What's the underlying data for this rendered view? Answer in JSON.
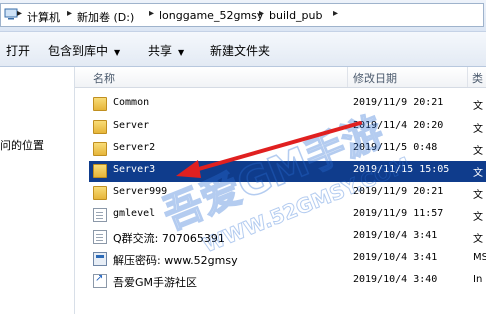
{
  "address": {
    "segments": [
      "计算机",
      "新加卷 (D:)",
      "longgame_52gmsy",
      "build_pub"
    ],
    "separator": "▸"
  },
  "toolbar": {
    "open_label": "打开",
    "include_label": "包含到库中",
    "share_label": "共享",
    "new_folder_label": "新建文件夹"
  },
  "nav": {
    "recent_places_label": "问的位置"
  },
  "columns": {
    "name": "名称",
    "modified": "修改日期",
    "type": "类"
  },
  "files": [
    {
      "name": "Common",
      "date": "2019/11/9 20:21",
      "type": "文",
      "icon": "folder-icon",
      "selected": false
    },
    {
      "name": "Server",
      "date": "2019/11/4 20:20",
      "type": "文",
      "icon": "folder-icon",
      "selected": false
    },
    {
      "name": "Server2",
      "date": "2019/11/5 0:48",
      "type": "文",
      "icon": "folder-icon",
      "selected": false
    },
    {
      "name": "Server3",
      "date": "2019/11/15 15:05",
      "type": "文",
      "icon": "folder-icon",
      "selected": true
    },
    {
      "name": "Server999",
      "date": "2019/11/9 20:21",
      "type": "文",
      "icon": "folder-icon",
      "selected": false
    },
    {
      "name": "gmlevel",
      "date": "2019/11/9 11:57",
      "type": "文",
      "icon": "file-icon",
      "selected": false
    },
    {
      "name": "Q群交流: 707065391",
      "date": "2019/10/4 3:41",
      "type": "文",
      "icon": "file-icon",
      "selected": false
    },
    {
      "name": "解压密码: www.52gmsy",
      "date": "2019/10/4 3:41",
      "type": "MS",
      "icon": "exe-icon",
      "selected": false
    },
    {
      "name": "吾爱GM手游社区",
      "date": "2019/10/4 3:40",
      "type": "In",
      "icon": "link-icon",
      "selected": false
    }
  ],
  "watermark": {
    "text_cn": "吾爱GM手游",
    "text_url": "WWW.52GMSY.COM"
  },
  "colors": {
    "selection": "#0f3c8c",
    "arrow": "#e02020"
  }
}
